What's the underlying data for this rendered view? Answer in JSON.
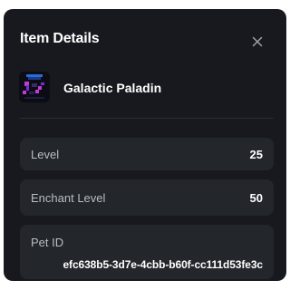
{
  "modal": {
    "title": "Item Details",
    "close_icon": "close-icon"
  },
  "pet": {
    "name": "Galactic Paladin",
    "thumbnail_icon": "pet-thumbnail",
    "accent_colors": [
      "#c23bd4",
      "#2a6bd8",
      "#7b2bd6"
    ]
  },
  "details": {
    "level_label": "Level",
    "level_value": "25",
    "enchant_label": "Enchant Level",
    "enchant_value": "50",
    "pet_id_label": "Pet ID",
    "pet_id_value": "efc638b5-3d7e-4cbb-b60f-cc111d53fe3c"
  },
  "colors": {
    "background": "#17191e",
    "card": "#23262b",
    "text_primary": "#ffffff",
    "text_secondary": "#b9bcc2"
  }
}
